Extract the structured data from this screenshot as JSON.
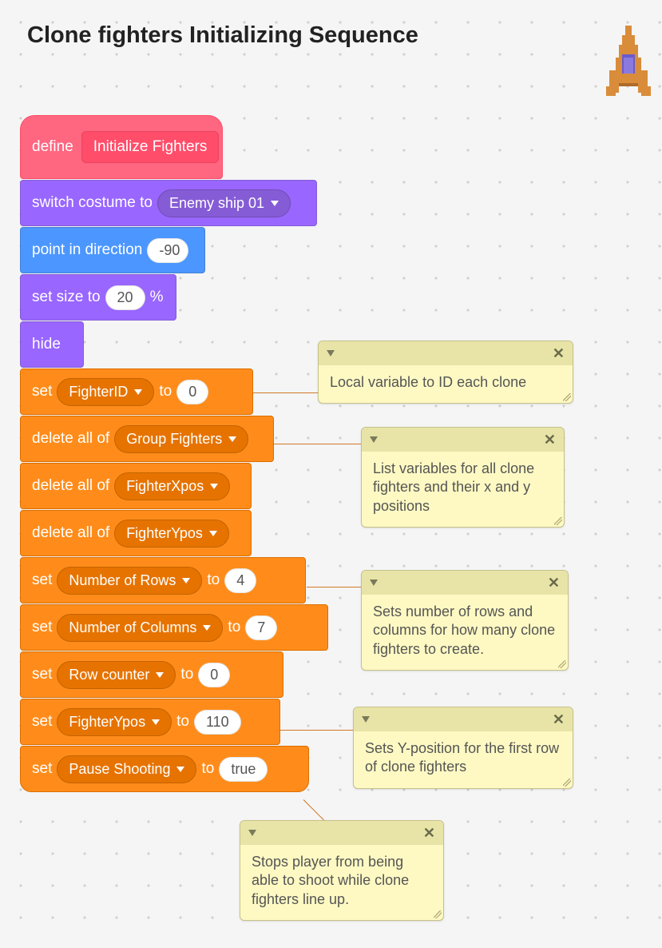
{
  "title": "Clone fighters Initializing Sequence",
  "define": {
    "keyword": "define",
    "name": "Initialize Fighters"
  },
  "blocks": {
    "switch_costume": {
      "label_pre": "switch costume to",
      "value": "Enemy ship 01"
    },
    "point_direction": {
      "label_pre": "point in direction",
      "value": "-90"
    },
    "set_size": {
      "label_pre": "set size to",
      "value": "20",
      "label_post": "%"
    },
    "hide": {
      "label": "hide"
    },
    "set_fighterid": {
      "label_pre": "set",
      "var": "FighterID",
      "label_mid": "to",
      "value": "0"
    },
    "delete_group": {
      "label_pre": "delete all of",
      "var": "Group Fighters"
    },
    "delete_xpos": {
      "label_pre": "delete all of",
      "var": "FighterXpos"
    },
    "delete_ypos": {
      "label_pre": "delete all of",
      "var": "FighterYpos"
    },
    "set_rows": {
      "label_pre": "set",
      "var": "Number of Rows",
      "label_mid": "to",
      "value": "4"
    },
    "set_cols": {
      "label_pre": "set",
      "var": "Number of Columns",
      "label_mid": "to",
      "value": "7"
    },
    "set_rowcounter": {
      "label_pre": "set",
      "var": "Row counter",
      "label_mid": "to",
      "value": "0"
    },
    "set_ypos": {
      "label_pre": "set",
      "var": "FighterYpos",
      "label_mid": "to",
      "value": "110"
    },
    "set_pause": {
      "label_pre": "set",
      "var": "Pause Shooting",
      "label_mid": "to",
      "value": "true"
    }
  },
  "comments": {
    "c1": "Local variable to ID each clone",
    "c2": "List variables for all clone fighters and their x and y positions",
    "c3": "Sets number of rows and columns for how many clone fighters to create.",
    "c4": "Sets Y-position for the first row of clone fighters",
    "c5": "Stops player from being able to shoot while clone fighters line up."
  }
}
